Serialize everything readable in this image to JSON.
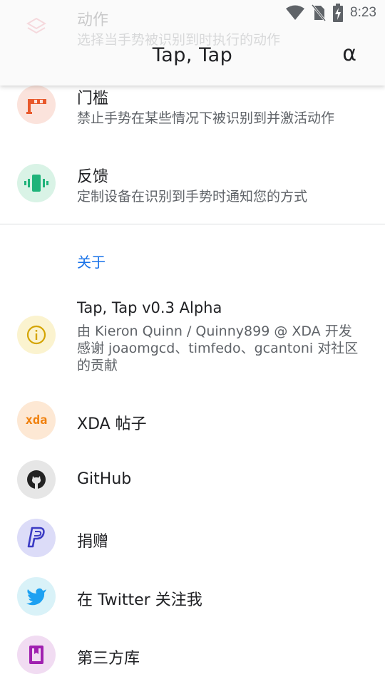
{
  "status_bar": {
    "time": "8:23",
    "icons": [
      "wifi-icon",
      "no-sim-icon",
      "battery-charging-icon"
    ]
  },
  "app_bar": {
    "title": "Tap, Tap",
    "action_label": "α"
  },
  "settings": [
    {
      "name": "actions",
      "title": "动作",
      "subtitle": "选择当手势被识别到时执行的动作",
      "icon": "layers-icon",
      "icon_bg": "#fde8ec",
      "icon_color": "#e8667a"
    },
    {
      "name": "gates",
      "title": "门槛",
      "subtitle": "禁止手势在某些情况下被识别到并激活动作",
      "icon": "barrier-icon",
      "icon_bg": "#fbe3dc",
      "icon_color": "#e8592c"
    },
    {
      "name": "feedback",
      "title": "反馈",
      "subtitle": "定制设备在识别到手势时通知您的方式",
      "icon": "vibration-icon",
      "icon_bg": "#d9f3e6",
      "icon_color": "#1fb37a"
    }
  ],
  "about": {
    "header": "关于",
    "app_info": {
      "title": "Tap, Tap v0.3 Alpha",
      "lines": [
        "由 Kieron Quinn / Quinny899 @ XDA 开发",
        "感谢 joaomgcd、timfedo、gcantoni 对社区",
        "的贡献"
      ],
      "icon": "info-icon",
      "icon_bg": "#fbf3cf",
      "icon_color": "#d4a400"
    },
    "links": [
      {
        "name": "xda",
        "label": "XDA 帖子",
        "icon": "xda-icon",
        "icon_text": "xda",
        "icon_bg": "#fde8d4",
        "icon_color": "#f0800c"
      },
      {
        "name": "github",
        "label": "GitHub",
        "icon": "github-icon",
        "icon_bg": "#e6e6e6",
        "icon_color": "#222222"
      },
      {
        "name": "donate",
        "label": "捐赠",
        "icon": "paypal-icon",
        "icon_bg": "#dcdcf8",
        "icon_color": "#3b3bc4"
      },
      {
        "name": "twitter",
        "label": "在 Twitter 关注我",
        "icon": "twitter-icon",
        "icon_bg": "#d9f2f8",
        "icon_color": "#1da1f2"
      },
      {
        "name": "libraries",
        "label": "第三方库",
        "icon": "book-icon",
        "icon_bg": "#f1dcf2",
        "icon_color": "#a020b0"
      }
    ]
  }
}
